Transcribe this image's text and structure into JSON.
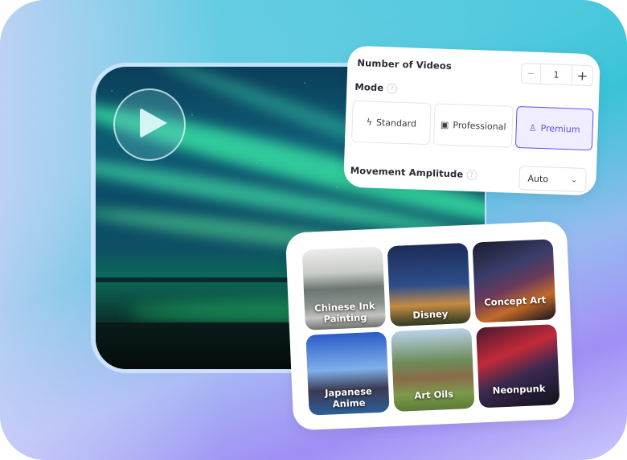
{
  "video": {
    "play_icon": "play-icon",
    "scene": "aurora-borealis-over-shore"
  },
  "settings": {
    "number_of_videos_label": "Number of Videos",
    "quantity": {
      "decrement_label": "−",
      "value": "1",
      "increment_label": "+"
    },
    "mode_label": "Mode",
    "help_glyph": "?",
    "modes": [
      {
        "label": "Standard",
        "icon": "lightning-icon",
        "glyph": "ϟ",
        "selected": false
      },
      {
        "label": "Professional",
        "icon": "hd-icon",
        "glyph": "▣",
        "selected": false
      },
      {
        "label": "Premium",
        "icon": "rocket-icon",
        "glyph": "♙",
        "selected": true
      }
    ],
    "movement_amplitude_label": "Movement Amplitude",
    "movement_amplitude_value": "Auto",
    "chevron_glyph": "⌄",
    "accent_color": "#5a52f0"
  },
  "styles": {
    "items": [
      {
        "label_line1": "Chinese Ink",
        "label_line2": "Painting"
      },
      {
        "label_line1": "Disney",
        "label_line2": ""
      },
      {
        "label_line1": "Concept Art",
        "label_line2": ""
      },
      {
        "label_line1": "Japanese",
        "label_line2": "Anime"
      },
      {
        "label_line1": "Art Oils",
        "label_line2": ""
      },
      {
        "label_line1": "Neonpunk",
        "label_line2": ""
      }
    ]
  }
}
